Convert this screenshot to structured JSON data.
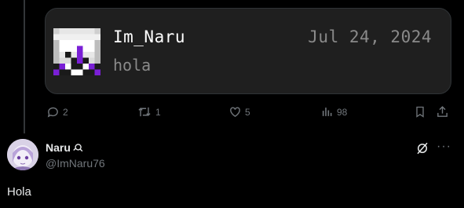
{
  "embed": {
    "name": "Im_Naru",
    "date": "Jul 24, 2024",
    "message": "hola"
  },
  "actions": {
    "replies": "2",
    "reposts": "1",
    "likes": "5",
    "views": "98"
  },
  "reply": {
    "display_name": "Naru",
    "handle": "@ImNaru76",
    "text": "Hola"
  },
  "icons": {
    "reply": "reply-icon",
    "repost": "repost-icon",
    "like": "heart-icon",
    "views": "views-icon",
    "bookmark": "bookmark-icon",
    "share": "share-icon",
    "grok": "grok-icon",
    "more": "more-icon"
  },
  "colors": {
    "background": "#000000",
    "card_bg": "#1f1f1f",
    "muted": "#71767b",
    "pixel_purple": "#7a1fd6"
  },
  "more_glyph": "···"
}
